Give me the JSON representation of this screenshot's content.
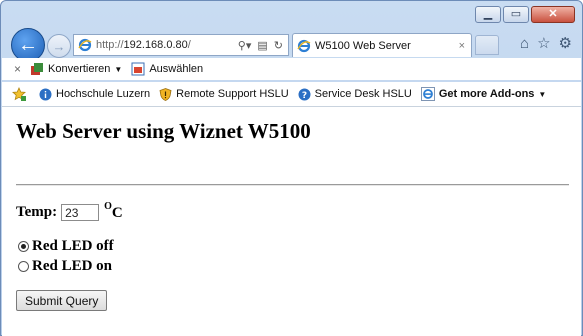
{
  "window": {
    "buttons": {
      "minimize": "▁",
      "maximize": "▭",
      "close": "✕"
    }
  },
  "nav": {
    "back_icon": "back-arrow-icon",
    "forward_icon": "forward-arrow-icon",
    "address": {
      "prefix": "http://",
      "host": "192.168.0.80",
      "suffix": "/"
    },
    "address_tools": [
      "search-icon",
      "compatibility-icon",
      "refresh-icon"
    ],
    "tab": {
      "title": "W5100 Web Server",
      "close": "×"
    },
    "tool_icons": [
      "home-icon",
      "favorites-star-icon",
      "settings-gear-icon"
    ]
  },
  "command_bar": {
    "close": "×",
    "items": [
      {
        "label": "Konvertieren",
        "icon": "convert-icon",
        "has_dropdown": true
      },
      {
        "label": "Auswählen",
        "icon": "select-icon",
        "has_dropdown": false
      }
    ]
  },
  "favorites_bar": {
    "items": [
      {
        "label": "Hochschule Luzern",
        "icon": "info-icon",
        "bold": false
      },
      {
        "label": "Remote Support HSLU",
        "icon": "shield-icon",
        "bold": false
      },
      {
        "label": "Service Desk HSLU",
        "icon": "help-icon",
        "bold": false
      },
      {
        "label": "Get more Add-ons",
        "icon": "ie-icon",
        "bold": true
      }
    ]
  },
  "page": {
    "heading": "Web Server using Wiznet W5100",
    "temp_label": "Temp:",
    "temp_value": "23",
    "temp_unit_sup": "O",
    "temp_unit": "C",
    "radios": [
      {
        "label": "Red LED off",
        "checked": true
      },
      {
        "label": "Red LED on",
        "checked": false
      }
    ],
    "submit_label": "Submit Query"
  },
  "colors": {
    "frame": "#c9dcf2",
    "accent_blue": "#1d5fb5",
    "close_red": "#c9513f"
  }
}
